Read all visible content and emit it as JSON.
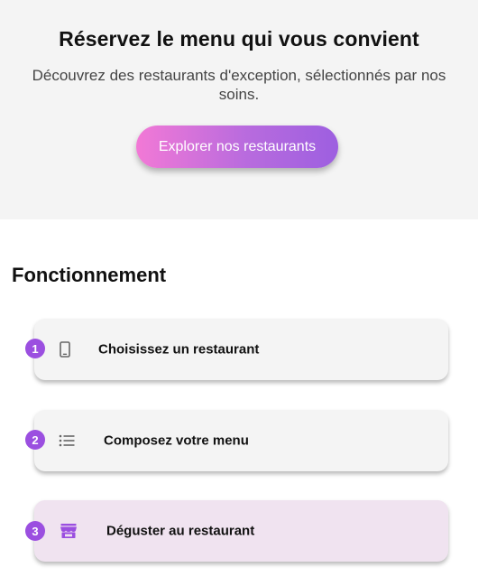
{
  "hero": {
    "title": "Réservez le menu qui vous convient",
    "subtitle": "Découvrez des restaurants d'exception, sélectionnés par nos soins.",
    "cta_label": "Explorer nos restaurants"
  },
  "how_it_works": {
    "title": "Fonctionnement",
    "steps": [
      {
        "number": "1",
        "icon": "smartphone-icon",
        "label": "Choisissez un restaurant"
      },
      {
        "number": "2",
        "icon": "list-icon",
        "label": "Composez votre menu"
      },
      {
        "number": "3",
        "icon": "storefront-icon",
        "label": "Déguster au restaurant"
      }
    ]
  },
  "colors": {
    "accent": "#9b4fe0",
    "cta_gradient_start": "#f279d6",
    "cta_gradient_end": "#9d5fe0",
    "highlight_card": "#f0e3f0"
  }
}
